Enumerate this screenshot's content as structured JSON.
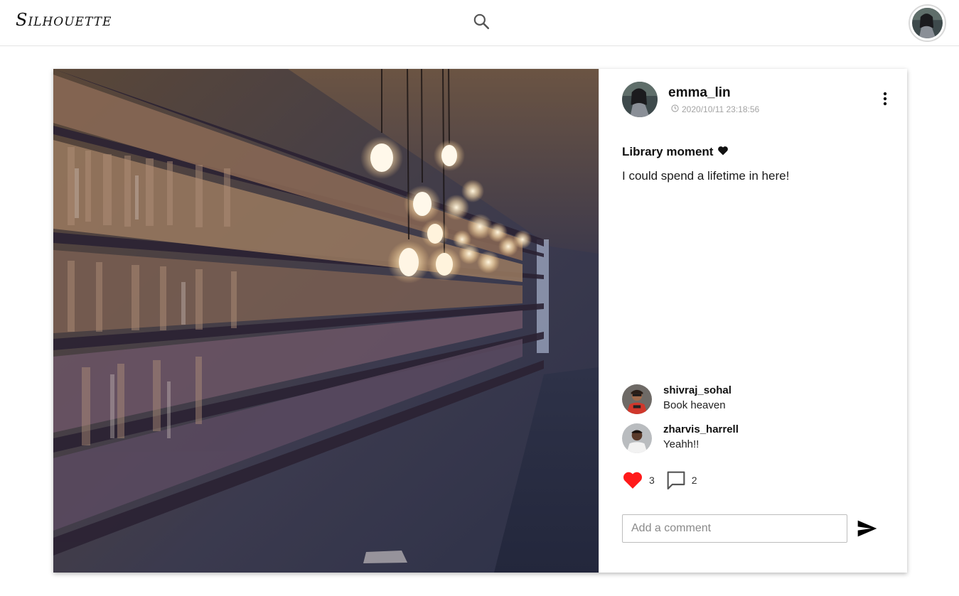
{
  "app": {
    "brand": "Silhouette"
  },
  "header": {
    "search_icon": "search-icon",
    "profile_avatar": "user-avatar"
  },
  "post": {
    "image": "library-bookshelves-photo",
    "author": "emma_lin",
    "timestamp": "2020/10/11 23:18:56",
    "caption_title": "Library moment",
    "caption_text": "I could spend a lifetime in here!",
    "comments": [
      {
        "user": "shivraj_sohal",
        "text": "Book heaven"
      },
      {
        "user": "zharvis_harrell",
        "text": "Yeahh!!"
      }
    ],
    "likes": "3",
    "comment_count": "2",
    "comment_placeholder": "Add a comment"
  },
  "colors": {
    "like": "#ff1a1a",
    "border": "#e4e4e4",
    "muted": "#a3a3a3"
  }
}
